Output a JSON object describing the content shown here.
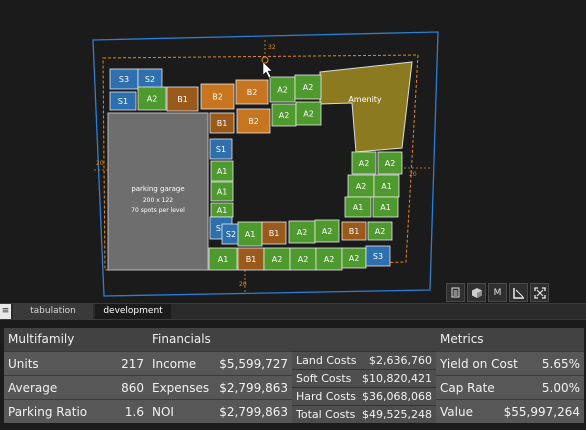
{
  "canvas": {
    "dimensions": {
      "top": "32",
      "left": "20",
      "right": "20",
      "bottom": "20"
    },
    "garage": {
      "title": "parking garage",
      "size": "200 x 122",
      "spots": "70 spots per level"
    },
    "amenity_label": "Amenity",
    "units": [
      "S3",
      "S2",
      "S1",
      "A2",
      "B1",
      "B2",
      "B2",
      "A2",
      "A2",
      "B1",
      "B2",
      "A2",
      "A2",
      "S1",
      "A1",
      "A1",
      "A1",
      "B1",
      "B1",
      "B1",
      "B1",
      "S2",
      "S2",
      "A1",
      "B1",
      "A2",
      "A2",
      "B1",
      "A1",
      "B1",
      "A2",
      "A2",
      "A2",
      "A2",
      "S3",
      "A2",
      "A2",
      "A2",
      "A2",
      "A1",
      "A1",
      "A1",
      "A1",
      "A1",
      "A1"
    ]
  },
  "toolbar": {
    "icons": [
      "report-icon",
      "cube-icon",
      "measure-icon",
      "corner-icon",
      "fullscreen-icon"
    ],
    "measure_label": "M"
  },
  "tabs": {
    "menu_glyph": "≡",
    "items": [
      "tabulation",
      "development"
    ],
    "active": "development"
  },
  "multifamily": {
    "title": "Multifamily",
    "rows": [
      {
        "label": "Units",
        "value": "217"
      },
      {
        "label": "Average",
        "value": "860"
      },
      {
        "label": "Parking Ratio",
        "value": "1.6"
      }
    ]
  },
  "financials": {
    "title": "Financials",
    "main": [
      {
        "label": "Income",
        "value": "$5,599,727"
      },
      {
        "label": "Expenses",
        "value": "$2,799,863"
      },
      {
        "label": "NOI",
        "value": "$2,799,863"
      }
    ],
    "costs": [
      {
        "label": "Land Costs",
        "value": "$2,636,760"
      },
      {
        "label": "Soft Costs",
        "value": "$10,820,421"
      },
      {
        "label": "Hard Costs",
        "value": "$36,068,068"
      },
      {
        "label": "Total Costs",
        "value": "$49,525,248"
      }
    ]
  },
  "metrics": {
    "title": "Metrics",
    "rows": [
      {
        "label": "Yield on Cost",
        "value": "5.65%"
      },
      {
        "label": "Cap Rate",
        "value": "5.00%"
      },
      {
        "label": "Value",
        "value": "$55,997,264"
      }
    ]
  },
  "colors": {
    "studio": "#2e6fb0",
    "a": "#4f9a2e",
    "b": "#9a5a1c",
    "b_top": "#c8751f",
    "amenity": "#8c7a20",
    "garage": "#6e6e6e",
    "boundary": "#2b7fd4",
    "setback": "#e08a1e"
  }
}
